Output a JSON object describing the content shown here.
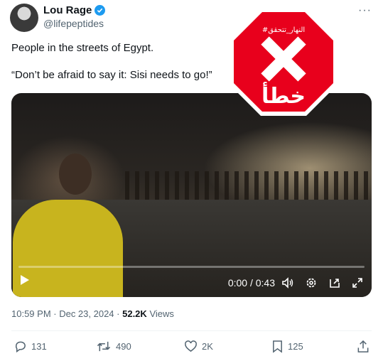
{
  "author": {
    "name": "Lou Rage",
    "handle": "@lifepeptides"
  },
  "more_icon": "···",
  "tweet": {
    "line1": "People in the streets of Egypt.",
    "line2": "“Don’t be afraid to say it: Sisi needs to go!”"
  },
  "overlay": {
    "hashtag": "#النهار_تتحقق",
    "verdict_word": "خطأ",
    "accent": "#e8001c"
  },
  "video": {
    "time": "0:00 / 0:43",
    "progress": 0
  },
  "meta": {
    "timestamp": "10:59 PM · Dec 23, 2024 ·",
    "views_count": "52.2K",
    "views_label": "Views"
  },
  "actions": {
    "replies": "131",
    "reposts": "490",
    "likes": "2K",
    "bookmarks": "125"
  },
  "colors": {
    "verified": "#1d9bf0",
    "muted": "#536471"
  }
}
